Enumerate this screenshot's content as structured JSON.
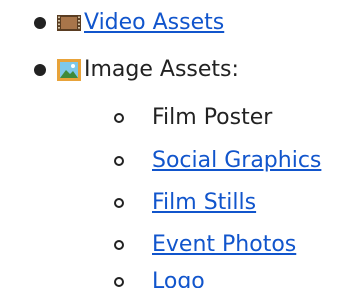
{
  "list": {
    "items": [
      {
        "icon": "film-strip-icon",
        "label": "Video Assets",
        "is_link": true
      },
      {
        "icon": "picture-icon",
        "label": "Image Assets:",
        "is_link": false,
        "children": [
          {
            "label": "Film Poster",
            "is_link": false
          },
          {
            "label": "Social Graphics",
            "is_link": true
          },
          {
            "label": "Film Stills",
            "is_link": true
          },
          {
            "label": "Event Photos",
            "is_link": true
          },
          {
            "label": "Logo",
            "is_link": true
          }
        ]
      }
    ]
  },
  "colors": {
    "link": "#1155cc",
    "text": "#222222",
    "background": "#ffffff"
  }
}
